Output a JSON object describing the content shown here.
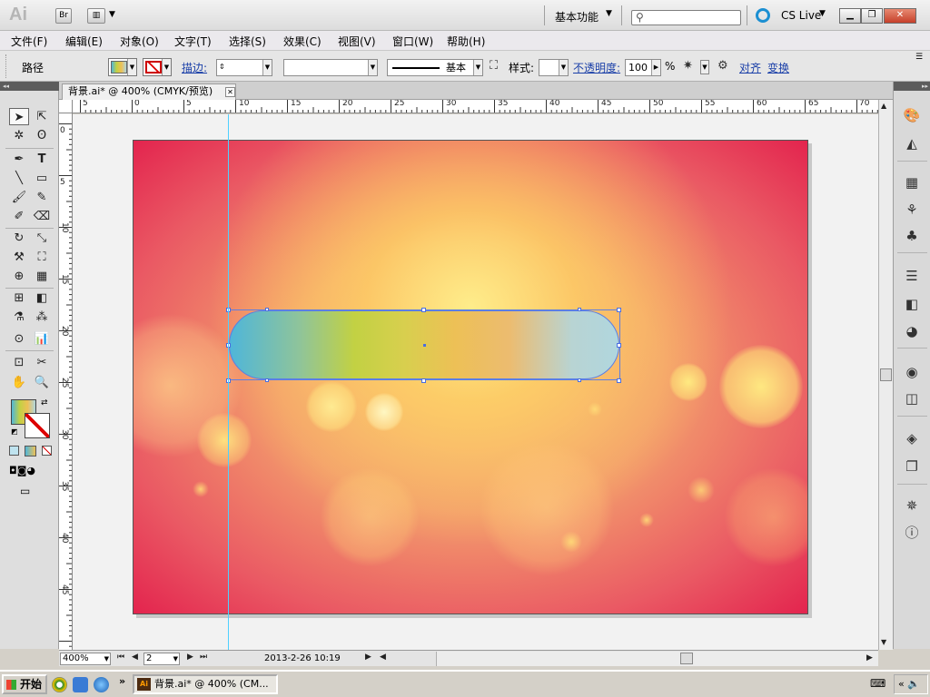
{
  "app": {
    "logo_text": "Ai",
    "bridge_label": "Br",
    "workspace_label": "基本功能",
    "cslive_label": "CS Live",
    "search_placeholder": ""
  },
  "menu": {
    "items": [
      "文件(F)",
      "编辑(E)",
      "对象(O)",
      "文字(T)",
      "选择(S)",
      "效果(C)",
      "视图(V)",
      "窗口(W)",
      "帮助(H)"
    ]
  },
  "control_bar": {
    "object_type": "路径",
    "stroke_label": "描边:",
    "stroke_profile_label": "基本",
    "style_label": "样式:",
    "opacity_label": "不透明度:",
    "opacity_value": "100",
    "opacity_unit": "%",
    "align_label": "对齐",
    "transform_label": "变换"
  },
  "document": {
    "tab_title": "背景.ai* @ 400% (CMYK/预览)"
  },
  "ruler": {
    "h_labels": [
      "5",
      "0",
      "5",
      "10",
      "15",
      "20",
      "25",
      "30",
      "35",
      "40",
      "45",
      "50",
      "55",
      "60",
      "65",
      "70"
    ],
    "v_labels": [
      "0",
      "5",
      "10",
      "15",
      "20",
      "25",
      "30",
      "35",
      "40",
      "45"
    ]
  },
  "status_bar": {
    "zoom_value": "400%",
    "artboard_value": "2",
    "date_text": "2013-2-26  10:19"
  },
  "taskbar": {
    "start_label": "开始",
    "task_label": "背景.ai* @ 400% (CM..."
  },
  "colors": {
    "selection": "#5c7ee3",
    "guide": "#4fd0ff",
    "artboard_edge": "#e3244e",
    "artboard_glow": "#ffef8c"
  }
}
